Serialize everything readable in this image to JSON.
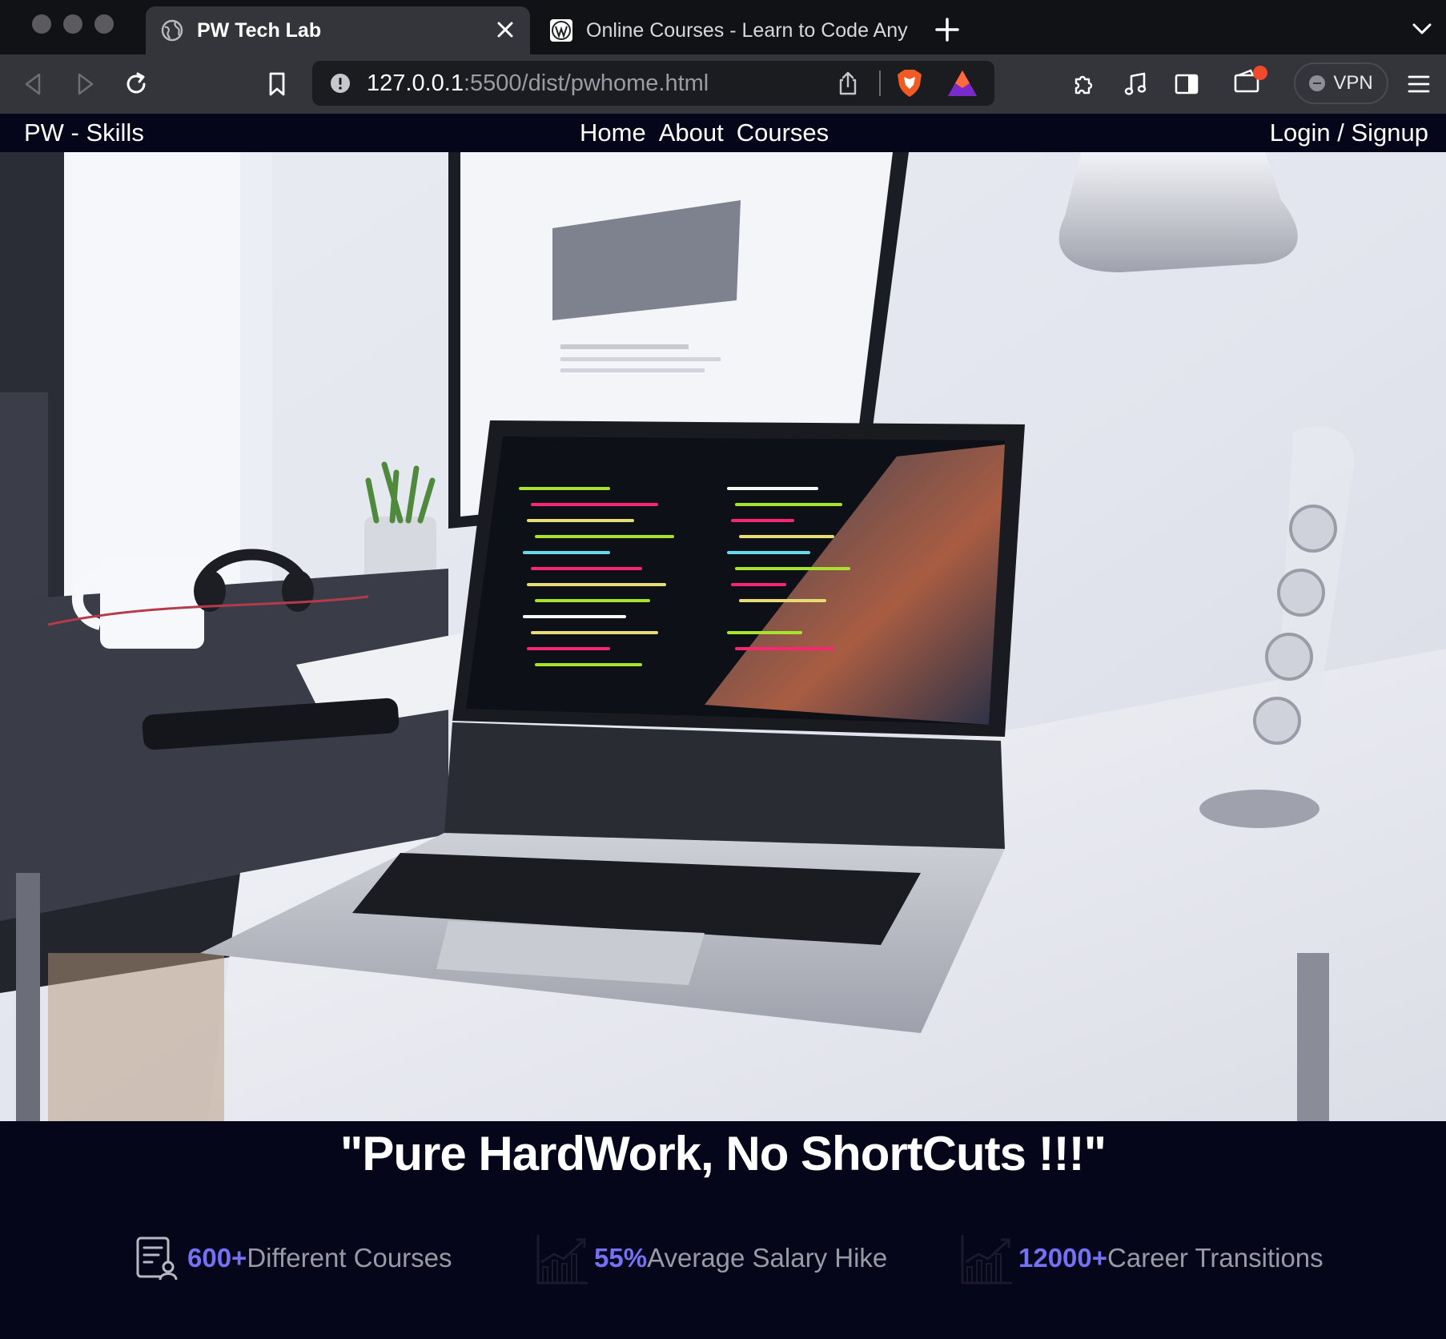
{
  "browser": {
    "tabs": [
      {
        "title": "PW Tech Lab",
        "active": true,
        "favicon": "globe-icon"
      },
      {
        "title": "Online Courses - Learn to Code Any",
        "active": false,
        "favicon": "wordpress-icon"
      }
    ],
    "url_host": "127.0.0.1",
    "url_path": ":5500/dist/pwhome.html",
    "vpn_label": "VPN",
    "notification_color": "#f04a2c",
    "brave_color": "#f15a22"
  },
  "nav": {
    "brand": "PW - Skills",
    "links": [
      "Home",
      "About",
      "Courses"
    ],
    "auth": "Login / Signup"
  },
  "hero": {
    "image": "desk-laptop-photo"
  },
  "tagline": "\"Pure HardWork, No ShortCuts !!!\"",
  "stats": [
    {
      "icon": "course-list-icon",
      "value": "600+",
      "label": "Different Courses"
    },
    {
      "icon": "bar-chart-icon",
      "value": "55%",
      "label": "Average Salary Hike"
    },
    {
      "icon": "bar-chart-icon",
      "value": "12000+",
      "label": "Career Transitions"
    }
  ],
  "colors": {
    "accent": "#7471f3",
    "page_bg": "#06061a",
    "chrome_bg": "#34353b"
  }
}
